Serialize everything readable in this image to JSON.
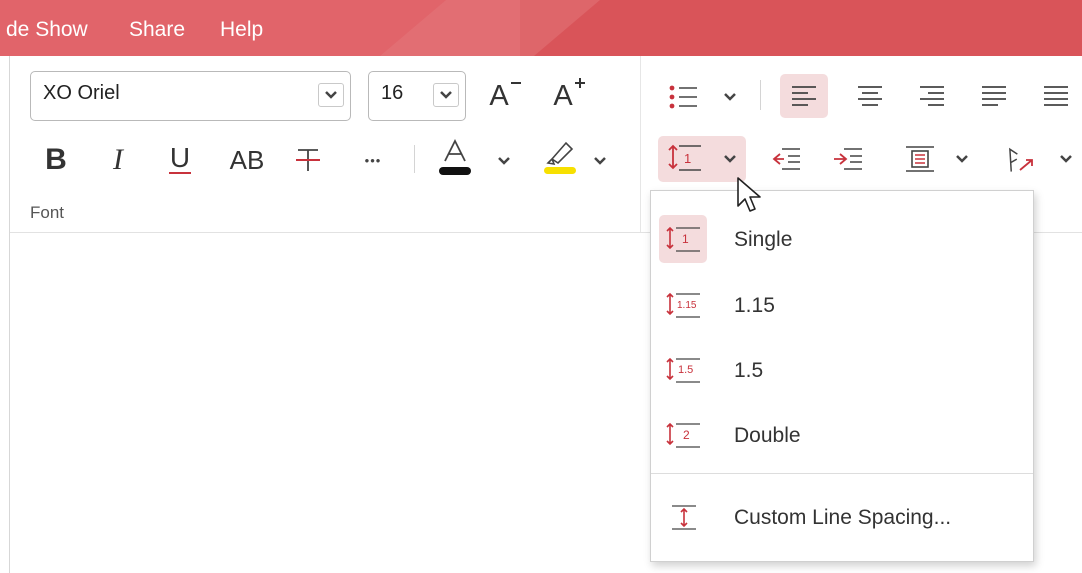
{
  "menu": {
    "items": [
      {
        "label": "de Show"
      },
      {
        "label": "Share"
      },
      {
        "label": "Help"
      }
    ]
  },
  "font": {
    "name": "XO Oriel",
    "size": "16",
    "group_label": "Font",
    "grow_label": "A",
    "shrink_label": "A",
    "bold_label": "B",
    "italic_label": "I",
    "underline_label": "U",
    "caps_label": "AB",
    "strike_label": "T",
    "more_label": "•••",
    "color_label": "A"
  },
  "colors": {
    "accent": "#e1646a",
    "font_color": "#111111",
    "highlight": "#f7e000",
    "active_bg": "#f4dcdd",
    "icon_red": "#c8323c"
  },
  "line_spacing_menu": {
    "items": [
      {
        "label": "Single",
        "icon": "line-spacing-single-icon",
        "badge": "1"
      },
      {
        "label": "1.15",
        "icon": "line-spacing-115-icon",
        "badge": "1.15"
      },
      {
        "label": "1.5",
        "icon": "line-spacing-15-icon",
        "badge": "1.5"
      },
      {
        "label": "Double",
        "icon": "line-spacing-double-icon",
        "badge": "2"
      }
    ],
    "custom_label": "Custom Line Spacing...",
    "selected": "Single"
  },
  "toolbar_badges": {
    "line_spacing_badge": "1"
  }
}
